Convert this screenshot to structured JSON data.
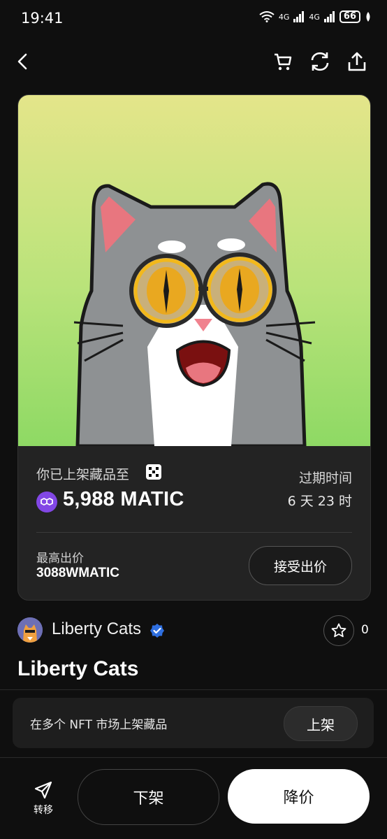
{
  "status_bar": {
    "time": "19:41",
    "network_1": "4G",
    "network_2": "4G",
    "battery": "66"
  },
  "nft_card": {
    "listed_text": "你已上架藏品至",
    "price": "5,988 MATIC",
    "expire_label": "过期时间",
    "expire_value": "6 天 23 时",
    "highest_offer_label": "最高出价",
    "highest_offer_value": "3088WMATIC",
    "accept_offer_button": "接受出价"
  },
  "collection": {
    "name": "Liberty Cats",
    "favorite_count": "0"
  },
  "nft_title": "Liberty Cats",
  "market_bar": {
    "text": "在多个 NFT 市场上架藏品",
    "list_button": "上架"
  },
  "actions": {
    "transfer_label": "转移",
    "delist_button": "下架",
    "reduce_price_button": "降价"
  },
  "icons": [
    "back-icon",
    "cart-icon",
    "refresh-icon",
    "share-icon",
    "matic-icon",
    "okx-icon",
    "verified-icon",
    "star-icon",
    "send-icon"
  ],
  "colors": {
    "background": "#0f0f0f",
    "card": "#232323",
    "matic": "#8247e5",
    "verified": "#2f6fe0"
  }
}
